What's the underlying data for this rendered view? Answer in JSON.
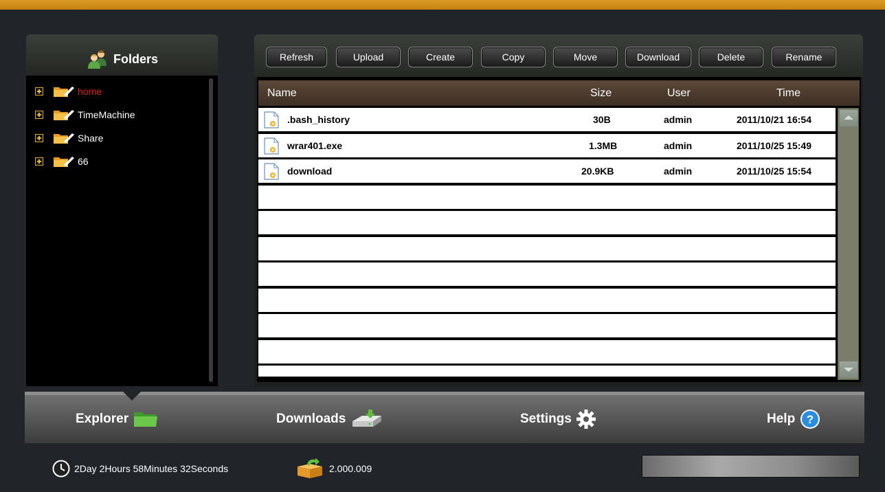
{
  "folders": {
    "title": "Folders",
    "items": [
      {
        "label": "home",
        "active": true
      },
      {
        "label": "TimeMachine",
        "active": false
      },
      {
        "label": "Share",
        "active": false
      },
      {
        "label": "66",
        "active": false
      }
    ]
  },
  "toolbar": {
    "refresh": "Refresh",
    "upload": "Upload",
    "create": "Create",
    "copy": "Copy",
    "move": "Move",
    "download": "Download",
    "delete": "Delete",
    "rename": "Rename"
  },
  "file_list": {
    "columns": {
      "name": "Name",
      "size": "Size",
      "user": "User",
      "time": "Time"
    },
    "rows": [
      {
        "name": ".bash_history",
        "size": "30B",
        "user": "admin",
        "time": "2011/10/21 16:54"
      },
      {
        "name": "wrar401.exe",
        "size": "1.3MB",
        "user": "admin",
        "time": "2011/10/25 15:49"
      },
      {
        "name": "download",
        "size": "20.9KB",
        "user": "admin",
        "time": "2011/10/25 15:54"
      }
    ]
  },
  "nav": {
    "explorer": "Explorer",
    "downloads": "Downloads",
    "settings": "Settings",
    "help": "Help"
  },
  "status": {
    "uptime": "2Day 2Hours 58Minutes 32Seconds",
    "version": "2.000.009"
  },
  "colors": {
    "top_bar": "#d08f1d",
    "active_folder": "#e21c1c",
    "explorer_icon": "#5dbb3c",
    "help_icon": "#2a8ee0"
  },
  "icons": {
    "folders_header": "users-icon",
    "folder": "folder-icon",
    "file": "file-icon",
    "uptime": "clock-icon",
    "version": "package-icon",
    "explorer": "folder-green-icon",
    "downloads": "download-drive-icon",
    "settings": "gear-icon",
    "help": "help-icon"
  }
}
